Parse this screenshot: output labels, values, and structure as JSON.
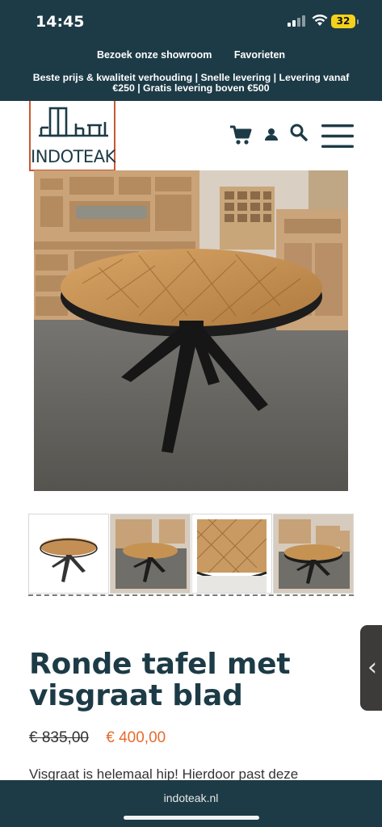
{
  "status_bar": {
    "time": "14:45",
    "battery": "32"
  },
  "top_links": [
    "Bezoek onze showroom",
    "Favorieten"
  ],
  "promo_text": "Beste prijs & kwaliteit verhouding | Snelle levering | Levering vanaf €250 | Gratis levering boven €500",
  "logo": {
    "text": "INDOTEAK"
  },
  "icons": [
    "cart-icon",
    "user-icon",
    "search-icon",
    "menu-icon",
    "chevron-left-icon"
  ],
  "product": {
    "title": "Ronde tafel met visgraat blad",
    "old_price": "€ 835,00",
    "new_price": "€ 400,00",
    "description": "Visgraat is helemaal hip! Hierdoor past deze"
  },
  "browser": {
    "url": "indoteak.nl"
  },
  "colors": {
    "brand_dark": "#1d3b46",
    "accent": "#e86a2c",
    "logo_border": "#c9582f"
  }
}
